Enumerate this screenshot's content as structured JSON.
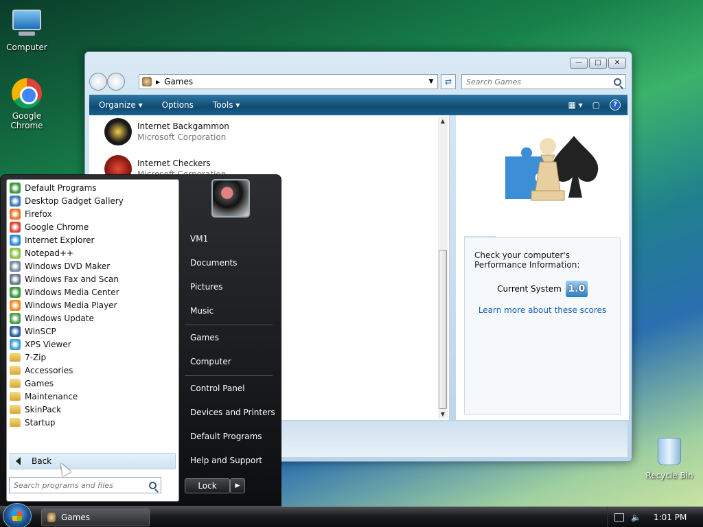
{
  "desktop": {
    "icons": [
      {
        "label": "Computer"
      },
      {
        "label": "Google Chrome"
      },
      {
        "label": "Recycle Bin"
      }
    ]
  },
  "explorer": {
    "address": "Games",
    "search_placeholder": "Search Games",
    "toolbar": {
      "organize": "Organize",
      "options": "Options",
      "tools": "Tools"
    },
    "games": [
      {
        "name": "Internet Backgammon",
        "publisher": "Microsoft Corporation"
      },
      {
        "name": "Internet Checkers",
        "publisher": "Microsoft Corporation"
      }
    ],
    "performance": {
      "heading": "Check your computer's Performance Information:",
      "current_label": "Current System",
      "score": "1.0",
      "link": "Learn more about these scores"
    }
  },
  "start_menu": {
    "programs": [
      {
        "label": "Default Programs",
        "icon": "default-programs-icon",
        "color": "#3a9a3a"
      },
      {
        "label": "Desktop Gadget Gallery",
        "icon": "gadget-icon",
        "color": "#3a7ac0"
      },
      {
        "label": "Firefox",
        "icon": "firefox-icon",
        "color": "#e8742a"
      },
      {
        "label": "Google Chrome",
        "icon": "chrome-icon",
        "color": "#db4437"
      },
      {
        "label": "Internet Explorer",
        "icon": "ie-icon",
        "color": "#2a8ad8"
      },
      {
        "label": "Notepad++",
        "icon": "notepad-icon",
        "color": "#8bc34a"
      },
      {
        "label": "Windows DVD Maker",
        "icon": "dvd-icon",
        "color": "#7a8a9a"
      },
      {
        "label": "Windows Fax and Scan",
        "icon": "fax-icon",
        "color": "#6a7a8a"
      },
      {
        "label": "Windows Media Center",
        "icon": "media-center-icon",
        "color": "#3a9a3a"
      },
      {
        "label": "Windows Media Player",
        "icon": "media-player-icon",
        "color": "#f08a20"
      },
      {
        "label": "Windows Update",
        "icon": "update-icon",
        "color": "#4aa04a"
      },
      {
        "label": "WinSCP",
        "icon": "winscp-icon",
        "color": "#2a5fa0"
      },
      {
        "label": "XPS Viewer",
        "icon": "xps-icon",
        "color": "#3aa0d8"
      },
      {
        "label": "7-Zip",
        "icon": "folder-icon",
        "color": "folder"
      },
      {
        "label": "Accessories",
        "icon": "folder-icon",
        "color": "folder"
      },
      {
        "label": "Games",
        "icon": "folder-icon",
        "color": "folder"
      },
      {
        "label": "Maintenance",
        "icon": "folder-icon",
        "color": "folder"
      },
      {
        "label": "SkinPack",
        "icon": "folder-icon",
        "color": "folder"
      },
      {
        "label": "Startup",
        "icon": "folder-icon",
        "color": "folder"
      }
    ],
    "back_label": "Back",
    "search_placeholder": "Search programs and files",
    "right_items": [
      "VM1",
      "Documents",
      "Pictures",
      "Music",
      "Games",
      "Computer",
      "Control Panel",
      "Devices and Printers",
      "Default Programs",
      "Help and Support"
    ],
    "lock_label": "Lock"
  },
  "taskbar": {
    "task_label": "Games",
    "clock": "1:01 PM"
  }
}
